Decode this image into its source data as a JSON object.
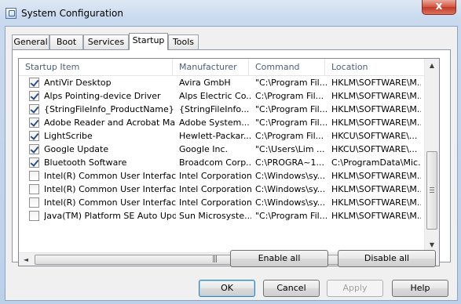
{
  "window": {
    "title": "System Configuration",
    "close_label": "x"
  },
  "tabs": [
    {
      "label": "General"
    },
    {
      "label": "Boot"
    },
    {
      "label": "Services"
    },
    {
      "label": "Startup"
    },
    {
      "label": "Tools"
    }
  ],
  "active_tab": "Startup",
  "table": {
    "columns": [
      "Startup Item",
      "Manufacturer",
      "Command",
      "Location"
    ],
    "rows": [
      {
        "checked": true,
        "item": "AntiVir Desktop",
        "manufacturer": "Avira GmbH",
        "command": "\"C:\\Program Fil...",
        "location": "HKLM\\SOFTWARE\\M..."
      },
      {
        "checked": true,
        "item": "Alps Pointing-device Driver",
        "manufacturer": "Alps Electric Co...",
        "command": "C:\\Program Fil...",
        "location": "HKLM\\SOFTWARE\\M..."
      },
      {
        "checked": true,
        "item": "{StringFileInfo_ProductName}",
        "manufacturer": "{StringFileInfo...",
        "command": "\"C:\\Program Fil...",
        "location": "HKLM\\SOFTWARE\\M..."
      },
      {
        "checked": true,
        "item": "Adobe Reader and Acrobat Man...",
        "manufacturer": "Adobe System...",
        "command": "\"C:\\Program Fil...",
        "location": "HKLM\\SOFTWARE\\M..."
      },
      {
        "checked": true,
        "item": "LightScribe",
        "manufacturer": "Hewlett-Packar...",
        "command": "C:\\Program Fil...",
        "location": "HKCU\\SOFTWARE\\..."
      },
      {
        "checked": true,
        "item": "Google Update",
        "manufacturer": "Google Inc.",
        "command": "\"C:\\Users\\Lim ...",
        "location": "HKCU\\SOFTWARE\\..."
      },
      {
        "checked": true,
        "item": "Bluetooth Software",
        "manufacturer": "Broadcom Corp...",
        "command": "C:\\PROGRA~1...",
        "location": "C:\\ProgramData\\Mic..."
      },
      {
        "checked": false,
        "item": "Intel(R) Common User Interface",
        "manufacturer": "Intel Corporation",
        "command": "C:\\Windows\\sy...",
        "location": "HKLM\\SOFTWARE\\M..."
      },
      {
        "checked": false,
        "item": "Intel(R) Common User Interface",
        "manufacturer": "Intel Corporation",
        "command": "C:\\Windows\\sy...",
        "location": "HKLM\\SOFTWARE\\M..."
      },
      {
        "checked": false,
        "item": "Intel(R) Common User Interface",
        "manufacturer": "Intel Corporation",
        "command": "C:\\Windows\\sy...",
        "location": "HKLM\\SOFTWARE\\M..."
      },
      {
        "checked": false,
        "item": "Java(TM) Platform SE Auto Upd...",
        "manufacturer": "Sun Microsyste...",
        "command": "\"C:\\Program Fil...",
        "location": "HKLM\\SOFTWARE\\M..."
      }
    ]
  },
  "scroll": {
    "up": "▲",
    "down": "▼",
    "left": "◄",
    "right": "►",
    "grip": "|||"
  },
  "buttons": {
    "enable_all": "Enable all",
    "disable_all": "Disable all",
    "ok": "OK",
    "cancel": "Cancel",
    "apply": "Apply",
    "help": "Help"
  },
  "icons": {
    "title": "msconfig-icon",
    "close": "close-icon"
  }
}
